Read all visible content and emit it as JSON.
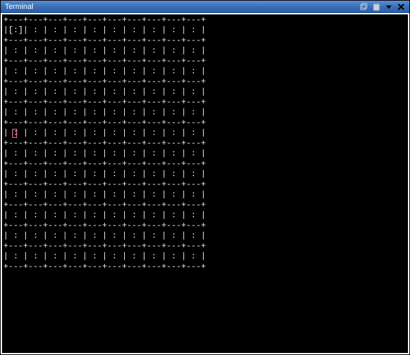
{
  "window": {
    "title": "Terminal"
  },
  "grid": {
    "cols": 10,
    "rows": 12,
    "cell_mark": ":",
    "corner": "+",
    "hseg": "---",
    "vbar": "|",
    "header_cell": "[:]",
    "cursor": {
      "row": 5,
      "col": 0
    }
  }
}
